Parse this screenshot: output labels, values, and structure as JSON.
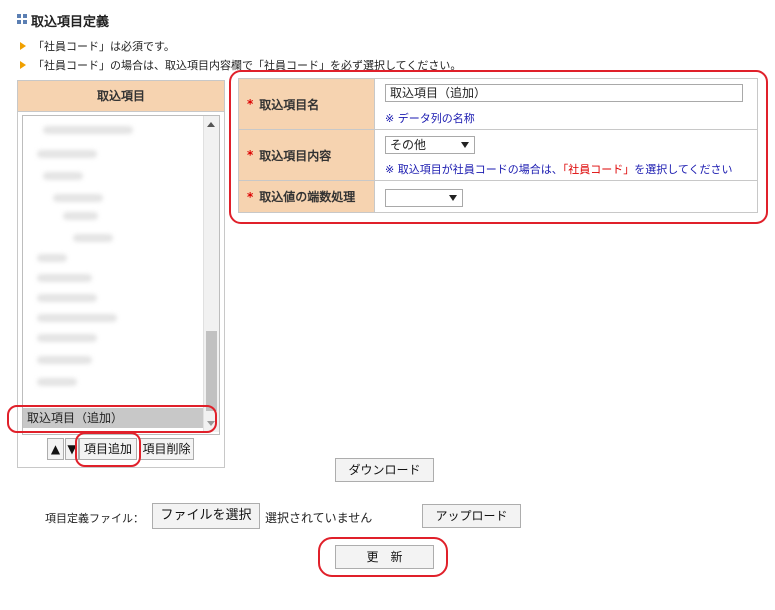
{
  "page": {
    "title": "取込項目定義",
    "notes": [
      "「社員コード」は必須です。",
      "「社員コード」の場合は、取込項目内容欄で「社員コード」を必ず選択してください。"
    ]
  },
  "list_panel": {
    "header": "取込項目",
    "selected_item": "取込項目（追加）",
    "buttons": {
      "up": "▲",
      "down": "▼",
      "add": "項目追加",
      "delete": "項目削除"
    }
  },
  "form": {
    "rows": [
      {
        "label": "取込項目名",
        "value": "取込項目（追加）",
        "hint": "※ データ列の名称"
      },
      {
        "label": "取込項目内容",
        "value": "その他",
        "hint_prefix": "※ 取込項目が社員コードの場合は、",
        "hint_red": "「社員コード」",
        "hint_suffix": "を選択してください"
      },
      {
        "label": "取込値の端数処理",
        "value": ""
      }
    ]
  },
  "actions": {
    "download": "ダウンロード",
    "file_label": "項目定義ファイル：",
    "choose_file": "ファイルを選択",
    "no_file": "選択されていません",
    "upload": "アップロード",
    "update": "更　新"
  },
  "colors": {
    "header_bg": "#f6d3b0",
    "highlight": "#e0202a",
    "hint": "#1a1ab0"
  }
}
